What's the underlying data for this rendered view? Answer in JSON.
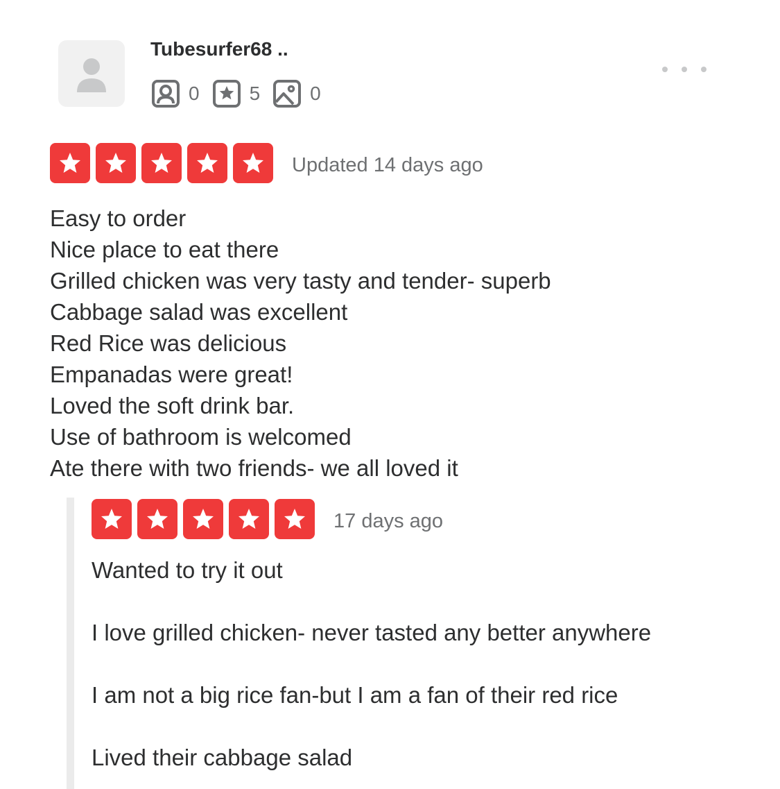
{
  "user": {
    "name": "Tubesurfer68 ..",
    "stats": [
      {
        "icon": "friends-icon",
        "value": "0"
      },
      {
        "icon": "reviews-star-icon",
        "value": "5"
      },
      {
        "icon": "photos-icon",
        "value": "0"
      }
    ]
  },
  "menu": {
    "icon": "more-options-icon"
  },
  "current_review": {
    "rating": 5,
    "date": "Updated 14 days ago",
    "lines": [
      "Easy to order",
      "Nice place to eat there",
      "Grilled chicken was very tasty and tender- superb",
      "Cabbage salad was excellent",
      "Red Rice was delicious",
      "Empanadas were great!",
      "Loved the soft drink bar.",
      "Use of bathroom is welcomed",
      "Ate there with two friends- we all loved it"
    ]
  },
  "previous_review": {
    "rating": 5,
    "date": "17 days ago",
    "lines": [
      "Wanted to try it out",
      "I love grilled chicken- never tasted any better anywhere",
      "I am not a big rice fan-but I am a fan of their red rice",
      "Lived their cabbage salad"
    ]
  },
  "colors": {
    "star_bg": "#ef3a3a",
    "text": "#2d2e2f",
    "muted": "#6e7072"
  }
}
